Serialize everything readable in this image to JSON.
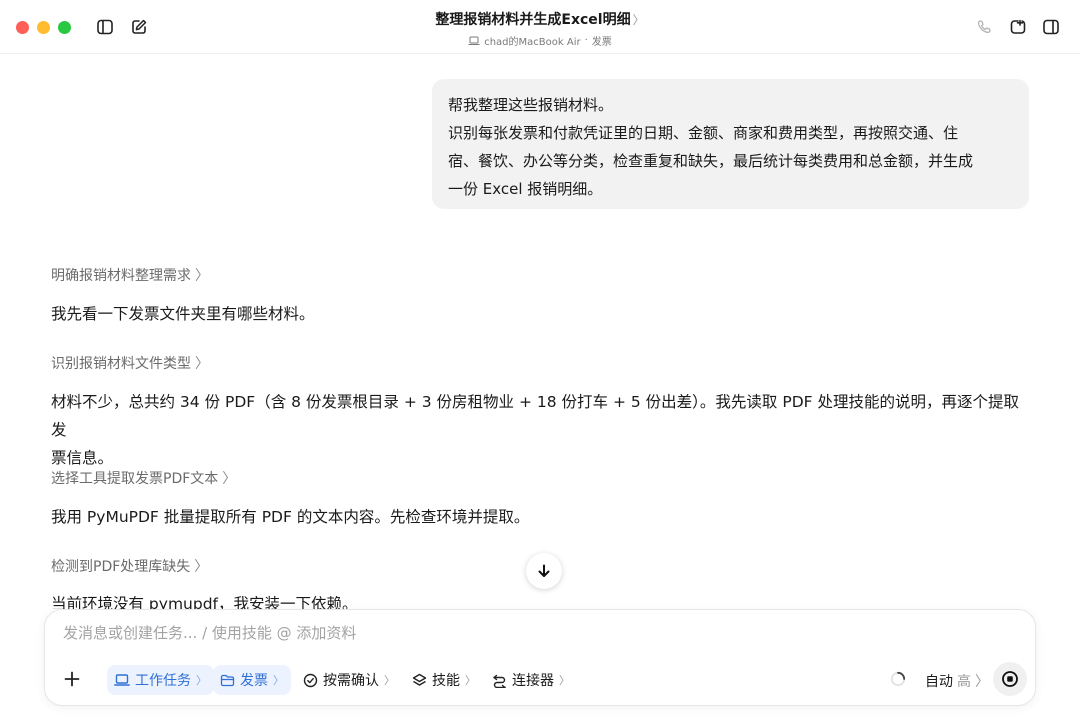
{
  "window": {
    "title": "整理报销材料并生成Excel明细",
    "title_chevron": "〉",
    "device": "chad的MacBook Air",
    "separator": "·",
    "folder": "发票"
  },
  "conversation": {
    "user_message_lines": [
      "帮我整理这些报销材料。",
      "识别每张发票和付款凭证里的日期、金额、商家和费用类型，再按照交通、住",
      "宿、餐饮、办公等分类，检查重复和缺失，最后统计每类费用和总金额，并生成",
      "一份 Excel 报销明细。"
    ],
    "steps": [
      {
        "title": "明确报销材料整理需求",
        "lines": [
          "我先看一下发票文件夹里有哪些材料。"
        ]
      },
      {
        "title": "识别报销材料文件类型",
        "lines": [
          "材料不少，总共约 34 份 PDF（含 8 份发票根目录 + 3 份房租物业 + 18 份打车 + 5 份出差）。我先读取 PDF 处理技能的说明，再逐个提取发",
          "票信息。"
        ]
      },
      {
        "title": "选择工具提取发票PDF文本",
        "lines": [
          "我用 PyMuPDF 批量提取所有 PDF 的文本内容。先检查环境并提取。"
        ]
      },
      {
        "title": "检测到PDF处理库缺失",
        "lines": [
          "当前环境没有 pymupdf，我安装一下依赖。"
        ]
      }
    ],
    "step_chevron": "〉"
  },
  "composer": {
    "placeholder": "发消息或创建任务... / 使用技能 @ 添加资料",
    "chips": {
      "work_task": "工作任务",
      "folder": "发票",
      "confirm": "按需确认",
      "skills": "技能",
      "connectors": "连接器"
    },
    "chip_chevron": "〉",
    "mode": "自动",
    "level": "高",
    "level_chevron": "〉"
  },
  "colors": {
    "accent_blue": "#2f6fd6",
    "chip_bg": "#ecf3fe",
    "bubble_bg": "#f2f2f3"
  },
  "icons": {
    "sidebar": "sidebar-toggle-icon",
    "new_chat": "edit-icon",
    "phone": "phone-icon",
    "new_window": "new-window-icon",
    "right_panel": "right-panel-icon",
    "scroll_down": "arrow-down-icon",
    "plus": "plus-icon",
    "stop": "stop-icon"
  }
}
